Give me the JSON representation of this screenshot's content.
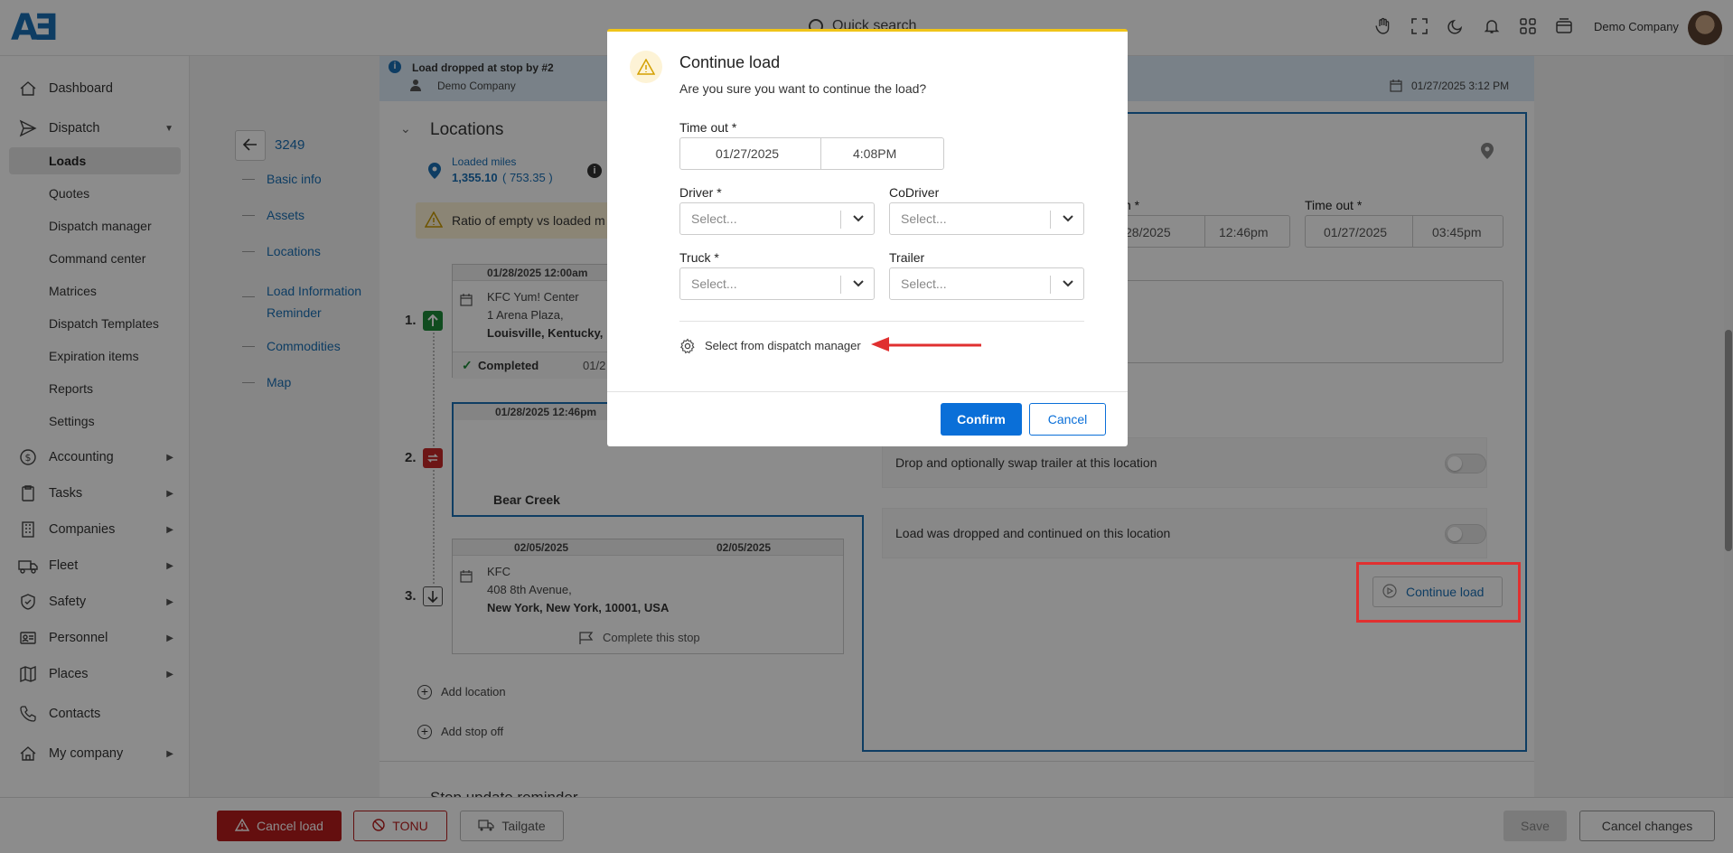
{
  "topbar": {
    "search_placeholder": "Quick search",
    "company": "Demo Company"
  },
  "sidebar": {
    "items": [
      {
        "label": "Dashboard",
        "icon": "dashboard-icon"
      },
      {
        "label": "Dispatch",
        "icon": "send-icon"
      },
      {
        "label": "Accounting",
        "icon": "dollar-icon"
      },
      {
        "label": "Tasks",
        "icon": "clipboard-icon"
      },
      {
        "label": "Companies",
        "icon": "building-icon"
      },
      {
        "label": "Fleet",
        "icon": "truck-icon"
      },
      {
        "label": "Safety",
        "icon": "shield-icon"
      },
      {
        "label": "Personnel",
        "icon": "id-card-icon"
      },
      {
        "label": "Places",
        "icon": "map-icon"
      },
      {
        "label": "Contacts",
        "icon": "phone-icon"
      },
      {
        "label": "My company",
        "icon": "home-icon"
      }
    ],
    "dispatch_sub": [
      "Loads",
      "Quotes",
      "Dispatch manager",
      "Command center",
      "Matrices",
      "Dispatch Templates",
      "Expiration items",
      "Reports",
      "Settings"
    ]
  },
  "banner": {
    "title": "Load dropped at stop by #2",
    "company": "Demo Company",
    "datetime": "01/27/2025 3:12 PM"
  },
  "load_nav": {
    "load_id": "3249",
    "links": [
      "Basic info",
      "Assets",
      "Locations",
      "Load Information Reminder",
      "Commodities",
      "Map"
    ]
  },
  "locations": {
    "title": "Locations",
    "loaded_miles_label": "Loaded miles",
    "loaded_miles_value": "1,355.10",
    "empty_miles_value": "( 753.35 )",
    "ratio_warning": "Ratio of empty vs loaded m",
    "stops": [
      {
        "num": "1.",
        "date": "01/28/2025 12:00am",
        "name": "KFC Yum! Center",
        "addr1": "1 Arena Plaza,",
        "addr2": "Louisville, Kentucky,",
        "status": "Completed",
        "status_date": "01/2"
      },
      {
        "num": "2.",
        "date": "01/28/2025 12:46pm",
        "name": "Bear Creek"
      },
      {
        "num": "3.",
        "date_from": "02/05/2025",
        "date_to": "02/05/2025",
        "name": "KFC",
        "addr1": "408 8th Avenue,",
        "addr2": "New York, New York, 10001, USA",
        "action": "Complete this stop"
      }
    ],
    "add_location": "Add location",
    "add_stop_off": "Add stop off",
    "next_section": "Stop update reminder"
  },
  "detail": {
    "time_in_label": "n *",
    "time_in_date": "28/2025",
    "time_in_time": "12:46pm",
    "time_out_label": "Time out *",
    "time_out_date": "01/27/2025",
    "time_out_time": "03:45pm",
    "drop_swap": "Drop and optionally swap trailer at this location",
    "dropped_continued": "Load was dropped and continued on this location",
    "continue_btn": "Continue load"
  },
  "modal": {
    "title": "Continue load",
    "message": "Are you sure you want to continue the load?",
    "time_out_label": "Time out *",
    "date": "01/27/2025",
    "time": "4:08PM",
    "driver_label": "Driver *",
    "codriver_label": "CoDriver",
    "truck_label": "Truck *",
    "trailer_label": "Trailer",
    "select_placeholder": "Select...",
    "dispatch_link": "Select from dispatch manager",
    "confirm": "Confirm",
    "cancel": "Cancel"
  },
  "bottombar": {
    "cancel_load": "Cancel load",
    "tonu": "TONU",
    "tailgate": "Tailgate",
    "save": "Save",
    "cancel_changes": "Cancel changes"
  },
  "colors": {
    "primary": "#1a6fb5",
    "danger": "#b71c1c",
    "annotation": "#e03030",
    "warning": "#f0c419"
  }
}
